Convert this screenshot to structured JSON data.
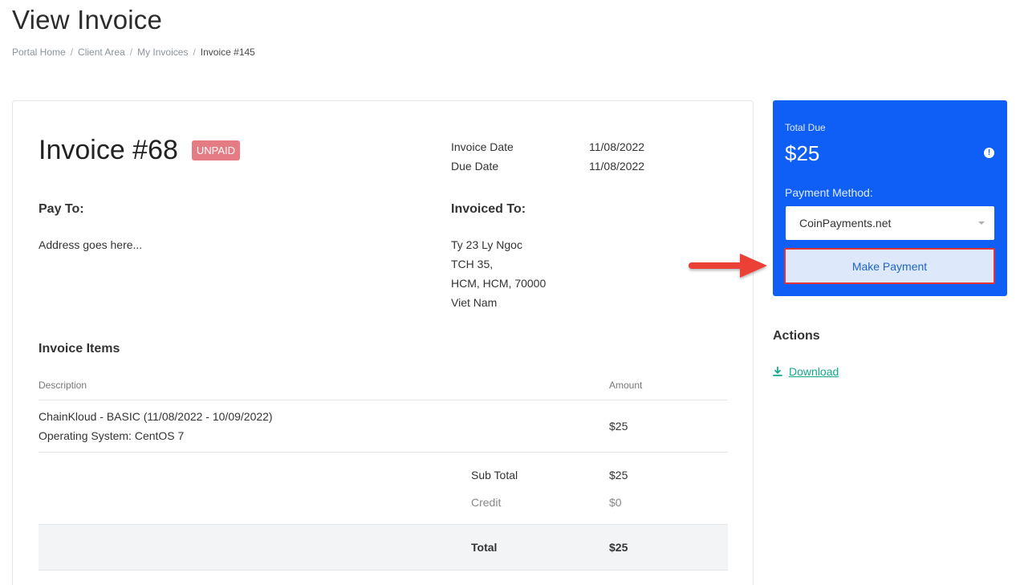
{
  "page": {
    "title": "View Invoice"
  },
  "breadcrumb": [
    "Portal Home",
    "Client Area",
    "My Invoices",
    "Invoice #145"
  ],
  "invoice": {
    "number": "Invoice #68",
    "status": "UNPAID",
    "invoice_date_label": "Invoice Date",
    "invoice_date": "11/08/2022",
    "due_date_label": "Due Date",
    "due_date": "11/08/2022",
    "pay_to_label": "Pay To:",
    "pay_to_address": "Address goes here...",
    "invoiced_to_label": "Invoiced To:",
    "invoiced_to_lines": [
      "Ty 23 Ly Ngoc",
      "TCH 35,",
      "HCM, HCM, 70000",
      "Viet Nam"
    ],
    "items_title": "Invoice Items",
    "columns": {
      "description": "Description",
      "amount": "Amount"
    },
    "items": [
      {
        "description": [
          "ChainKloud - BASIC (11/08/2022 - 10/09/2022)",
          "Operating System: CentOS 7"
        ],
        "amount": "$25"
      }
    ],
    "sub_total_label": "Sub Total",
    "sub_total": "$25",
    "credit_label": "Credit",
    "credit": "$0",
    "total_label": "Total",
    "total": "$25"
  },
  "payment": {
    "total_due_label": "Total Due",
    "total_due": "$25",
    "method_label": "Payment Method:",
    "method_selected": "CoinPayments.net",
    "button_label": "Make Payment",
    "accent_color": "#0f5ff7",
    "highlight_color": "#e3333a"
  },
  "actions": {
    "title": "Actions",
    "download_label": "Download",
    "download_icon": "download-icon"
  }
}
